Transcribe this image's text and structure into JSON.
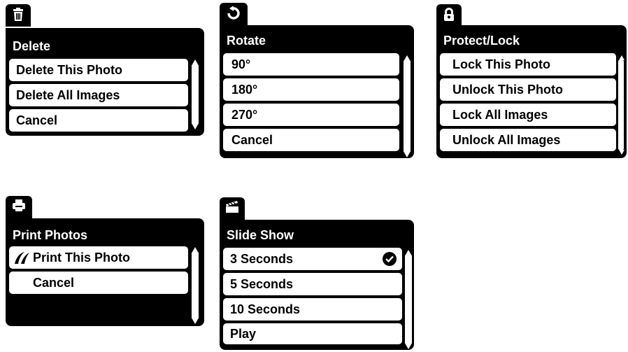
{
  "menus": {
    "delete": {
      "icon": "trash-icon",
      "title": "Delete",
      "items": [
        "Delete This Photo",
        "Delete All Images",
        "Cancel"
      ]
    },
    "rotate": {
      "icon": "rotate-icon",
      "title": "Rotate",
      "items": [
        "90°",
        "180°",
        "270°",
        "Cancel"
      ]
    },
    "protect": {
      "icon": "lock-icon",
      "title": "Protect/Lock",
      "items": [
        "Lock This Photo",
        "Unlock This Photo",
        "Lock All Images",
        "Unlock All Images"
      ]
    },
    "print": {
      "icon": "print-icon",
      "title": "Print Photos",
      "items": [
        "Print This Photo",
        "Cancel"
      ],
      "item_icon": "pictbridge-icon"
    },
    "slideshow": {
      "icon": "clapperboard-icon",
      "title": "Slide Show",
      "items": [
        "3 Seconds",
        "5 Seconds",
        "10 Seconds",
        "Play"
      ],
      "selected_icon": "checkmark-icon",
      "selected_item": "3 Seconds"
    }
  },
  "colors": {
    "menu_bg": "#000000",
    "item_bg": "#ffffff",
    "text": "#000000"
  }
}
